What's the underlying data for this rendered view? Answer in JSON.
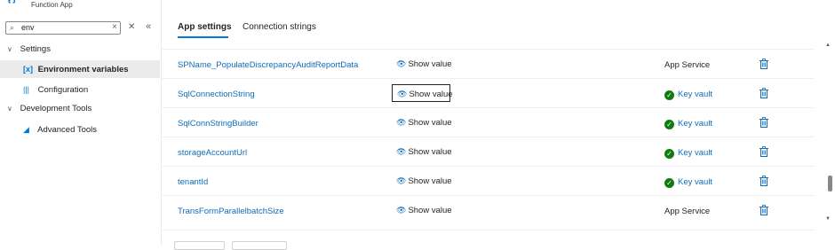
{
  "app": {
    "subtitle": "Function App",
    "icon": "function-app-icon"
  },
  "search": {
    "value": "env",
    "icon": "search-icon"
  },
  "sidebar": {
    "items": [
      {
        "label": "Settings",
        "expanded": true,
        "icon": "chevron-down-icon"
      },
      {
        "label": "Environment variables",
        "selected": true,
        "icon": "environment-variables-icon"
      },
      {
        "label": "Configuration",
        "icon": "configuration-icon"
      },
      {
        "label": "Development Tools",
        "expanded": true,
        "icon": "chevron-down-icon"
      },
      {
        "label": "Advanced Tools",
        "icon": "advanced-tools-icon"
      }
    ]
  },
  "tabs": [
    {
      "label": "App settings",
      "active": true
    },
    {
      "label": "Connection strings",
      "active": false
    }
  ],
  "table": {
    "rows": [
      {
        "name": "SPName_PopulateDiscrepancyAuditReportData",
        "value": "Show value",
        "source": "App Service",
        "keyvault": false
      },
      {
        "name": "SqlConnectionString",
        "value": "Show value",
        "source": "Key vault",
        "keyvault": true,
        "focused": true
      },
      {
        "name": "SqlConnStringBuilder",
        "value": "Show value",
        "source": "Key vault",
        "keyvault": true
      },
      {
        "name": "storageAccountUrl",
        "value": "Show value",
        "source": "Key vault",
        "keyvault": true
      },
      {
        "name": "tenantId",
        "value": "Show value",
        "source": "Key vault",
        "keyvault": true
      },
      {
        "name": "TransFormParallelbatchSize",
        "value": "Show value",
        "source": "App Service",
        "keyvault": false
      }
    ]
  },
  "colors": {
    "accent": "#0078d4",
    "link": "#0f6cbd",
    "success": "#107c10"
  }
}
